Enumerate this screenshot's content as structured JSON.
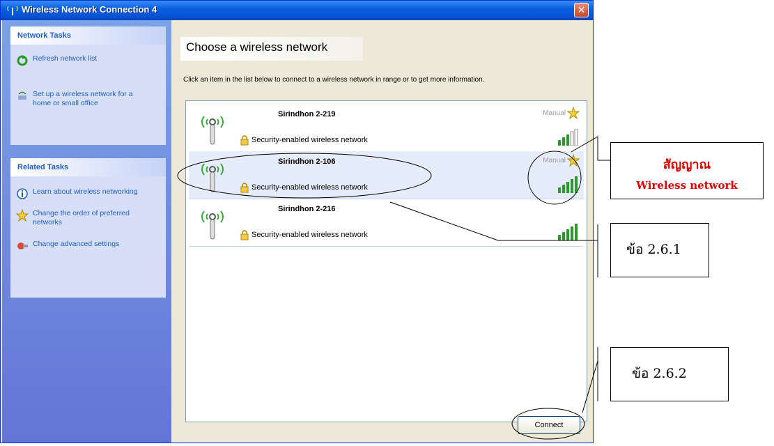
{
  "window": {
    "title": "Wireless Network Connection 4",
    "close_glyph": "✕"
  },
  "taskpane": {
    "network_tasks": {
      "header": "Network Tasks",
      "items": [
        {
          "label": "Refresh network list",
          "icon": "refresh-icon"
        },
        {
          "label": "Set up a wireless network for a home or small office",
          "icon": "setup-wireless-icon"
        }
      ]
    },
    "related_tasks": {
      "header": "Related Tasks",
      "items": [
        {
          "label": "Learn about wireless networking",
          "icon": "info-icon"
        },
        {
          "label": "Change the order of preferred networks",
          "icon": "star-icon"
        },
        {
          "label": "Change advanced settings",
          "icon": "settings-icon"
        }
      ]
    }
  },
  "main": {
    "title": "Choose a wireless network",
    "description": "Click an item in the list below to connect to a wireless network in range or to get more information.",
    "networks": [
      {
        "name": "Sirindhon 2-219",
        "security": "Security-enabled wireless network",
        "badge": "Manual",
        "signal": 0.6
      },
      {
        "name": "Sirindhon 2-106",
        "security": "Security-enabled wireless network",
        "badge": "Manual",
        "signal": 1.0,
        "selected": true
      },
      {
        "name": "Sirindhon 2-216",
        "security": "Security-enabled wireless network",
        "badge": "",
        "signal": 1.0
      }
    ],
    "connect_label": "Connect"
  },
  "annotations": {
    "signal_th": "สัญญาณ",
    "signal_en": "Wireless network",
    "step_261": "ข้อ 2.6.1",
    "step_262": "ข้อ 2.6.2"
  },
  "colors": {
    "accent_title": "#0553d7",
    "task_link": "#215dc6",
    "annotation_red": "#e00000"
  }
}
